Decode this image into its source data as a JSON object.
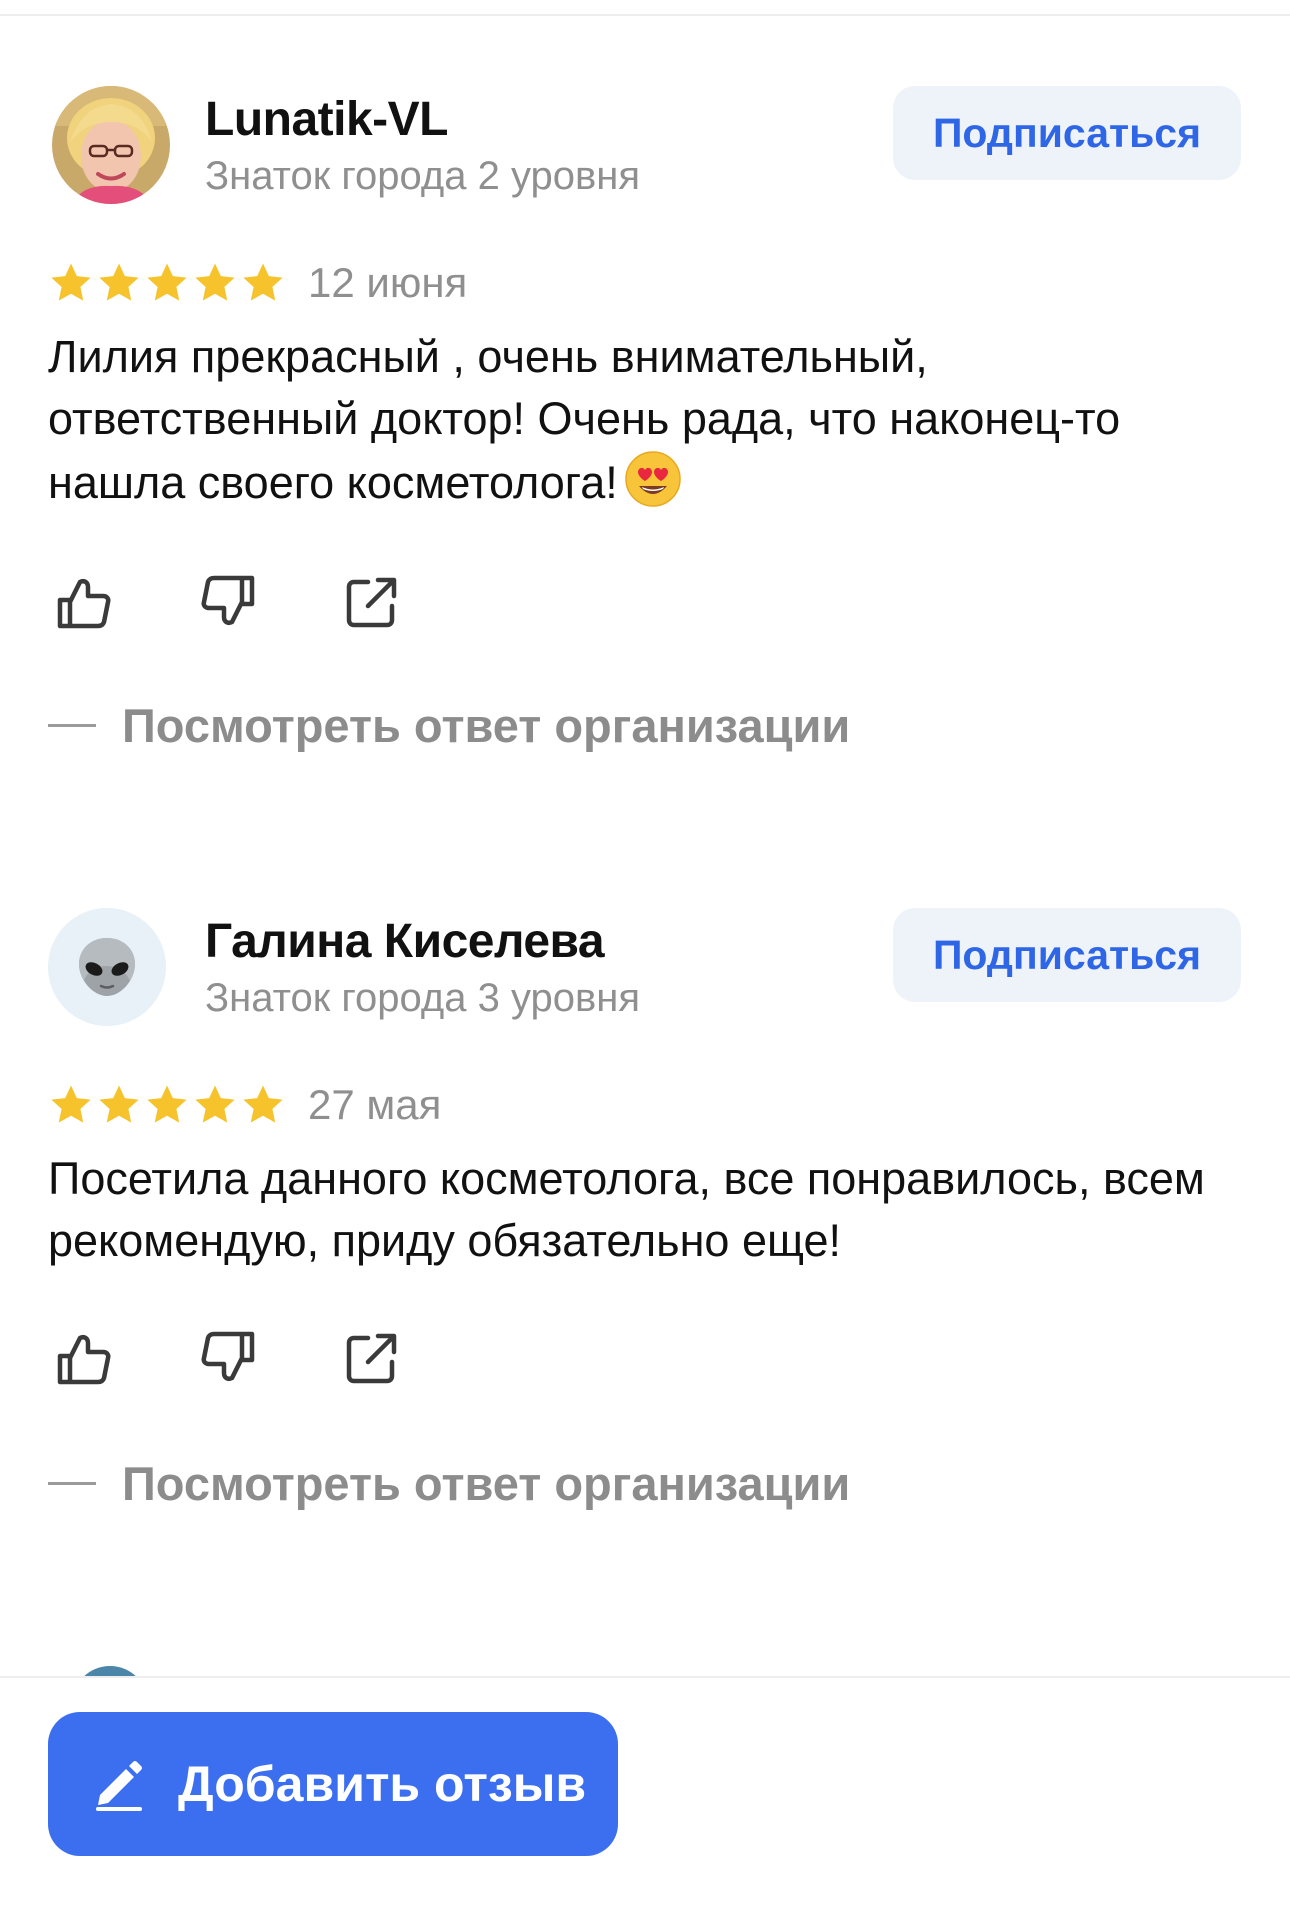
{
  "reviews": [
    {
      "author": "Lunatik-VL",
      "level": "Знаток города 2 уровня",
      "subscribe_label": "Подписаться",
      "rating": 5,
      "date": "12 июня",
      "text": "Лилия прекрасный , очень внимательный, ответственный доктор! Очень рада, что наконец-то нашла своего косметолога!",
      "emoji": "heart-eyes-emoji",
      "org_response_label": "Посмотреть ответ организации"
    },
    {
      "author": "Галина Киселева",
      "level": "Знаток города 3 уровня",
      "subscribe_label": "Подписаться",
      "rating": 5,
      "date": "27 мая",
      "text": "Посетила данного косметолога, все понравилось, всем рекомендую, приду обязательно еще!",
      "avatar_icon": "alien-icon",
      "org_response_label": "Посмотреть ответ организации"
    }
  ],
  "actions": {
    "like_icon": "thumbs-up-icon",
    "dislike_icon": "thumbs-down-icon",
    "share_icon": "share-icon"
  },
  "bottom": {
    "add_review_label": "Добавить отзыв",
    "add_review_icon": "pencil-icon"
  },
  "colors": {
    "accent": "#3c6ff0",
    "subscribe_text": "#2f66e6",
    "subscribe_bg": "#eef3fa",
    "star": "#f6c32c",
    "muted_text": "#8f8f8f"
  }
}
